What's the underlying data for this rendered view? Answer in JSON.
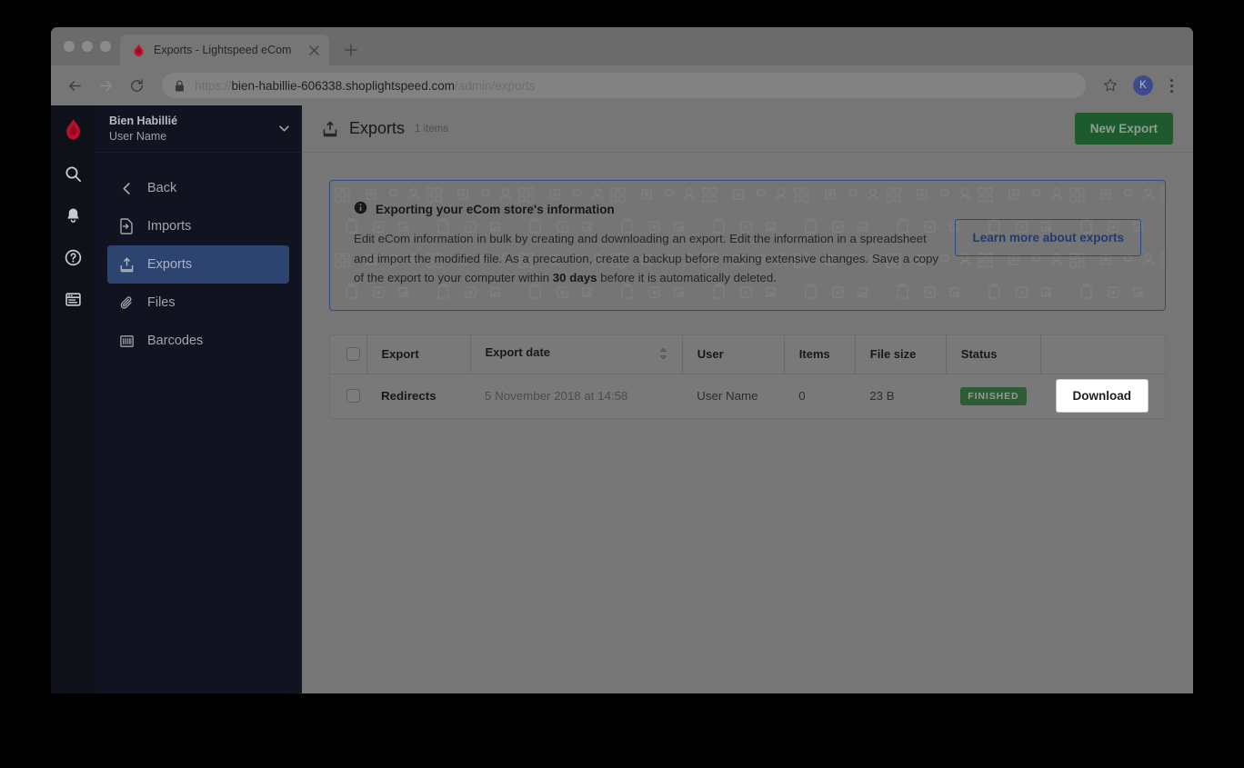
{
  "browser": {
    "tab": {
      "title": "Exports - Lightspeed eCom",
      "favicon": "lightspeed-flame-icon",
      "close": "×"
    },
    "new_tab_label": "+",
    "back_icon": "←",
    "forward_icon": "→",
    "reload_icon": "⟳",
    "lock_icon": "lock-icon",
    "url": {
      "scheme": "https://",
      "host": "bien-habillie-606338.shoplightspeed.com",
      "path": "/admin/exports"
    },
    "star_icon": "☆",
    "avatar_initial": "K",
    "menu_icon": "kebab-menu-icon"
  },
  "sidebar": {
    "store_name": "Bien Habillié",
    "user_name": "User Name",
    "caret": "▾",
    "rail_icons": [
      "search-icon",
      "bell-icon",
      "help-icon",
      "store-icon"
    ],
    "logo": "lightspeed-logo",
    "items": [
      {
        "label": "Back",
        "icon": "chevron-left-icon",
        "active": false
      },
      {
        "label": "Imports",
        "icon": "import-file-icon",
        "active": false
      },
      {
        "label": "Exports",
        "icon": "export-upload-icon",
        "active": true
      },
      {
        "label": "Files",
        "icon": "paperclip-icon",
        "active": false
      },
      {
        "label": "Barcodes",
        "icon": "barcode-icon",
        "active": false
      }
    ]
  },
  "header": {
    "icon": "export-upload-icon",
    "title": "Exports",
    "count": "1 items",
    "new_export_label": "New Export"
  },
  "banner": {
    "info_icon": "info-circle-icon",
    "title": "Exporting your eCom store's information",
    "text_part1": "Edit eCom information in bulk by creating and downloading an export. Edit the information in a spreadsheet and import the modified file. As a precaution, create a backup before making extensive changes. Save a copy of the export to your computer within ",
    "text_bold": "30 days",
    "text_part2": " before it is automatically deleted.",
    "learn_more_label": "Learn more about exports"
  },
  "table": {
    "columns": [
      {
        "key": "check",
        "label": ""
      },
      {
        "key": "export",
        "label": "Export"
      },
      {
        "key": "date",
        "label": "Export date",
        "sortable": true,
        "sort_icon": "sort-updown-icon"
      },
      {
        "key": "user",
        "label": "User"
      },
      {
        "key": "items",
        "label": "Items"
      },
      {
        "key": "filesize",
        "label": "File size"
      },
      {
        "key": "status",
        "label": "Status"
      },
      {
        "key": "action",
        "label": ""
      }
    ],
    "rows": [
      {
        "export": "Redirects",
        "date": "5 November 2018 at 14:58",
        "user": "User Name",
        "items": "0",
        "filesize": "23 B",
        "status": "FINISHED",
        "action": "Download"
      }
    ]
  },
  "colors": {
    "accent_green": "#1d5b2e",
    "accent_blue": "#2a4a80",
    "sidebar_bg": "#111420",
    "rail_bg": "#0e1118",
    "active_nav": "#2d4370",
    "status_green": "#2e5c36"
  }
}
